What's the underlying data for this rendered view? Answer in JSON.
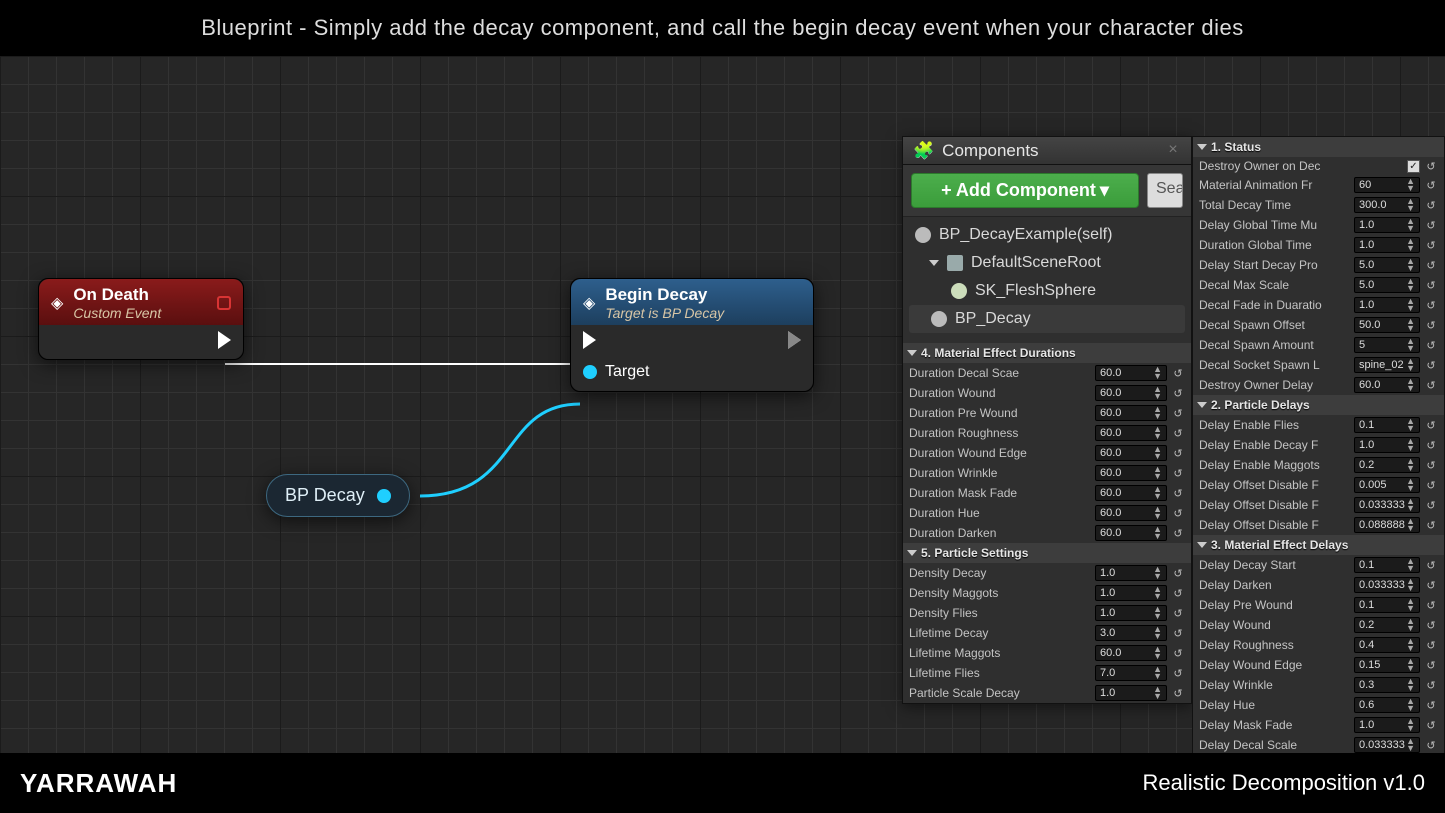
{
  "header": {
    "title": "Blueprint - Simply add the decay component, and call the begin decay event when your character dies"
  },
  "footer": {
    "brand": "YARRAWAH",
    "product": "Realistic Decomposition   v1.0"
  },
  "nodes": {
    "onDeath": {
      "title": "On Death",
      "subtitle": "Custom Event"
    },
    "beginDecay": {
      "title": "Begin Decay",
      "subtitle": "Target is BP Decay",
      "targetLabel": "Target"
    },
    "variable": {
      "label": "BP Decay"
    }
  },
  "componentsPanel": {
    "title": "Components",
    "addLabel": "+ Add Component",
    "searchPlaceholder": "Sea",
    "items": [
      {
        "label": "BP_DecayExample(self)",
        "indent": 0,
        "icon": "sphere"
      },
      {
        "label": "DefaultSceneRoot",
        "indent": 1,
        "icon": "cube",
        "expandable": true
      },
      {
        "label": "SK_FleshSphere",
        "indent": 2,
        "icon": "skel"
      },
      {
        "label": "BP_Decay",
        "indent": 1,
        "icon": "sphere",
        "selected": true
      }
    ]
  },
  "details": {
    "sec4": {
      "title": "4. Material Effect Durations",
      "rows": [
        {
          "label": "Duration Decal Scae",
          "value": "60.0"
        },
        {
          "label": "Duration Wound",
          "value": "60.0"
        },
        {
          "label": "Duration Pre Wound",
          "value": "60.0"
        },
        {
          "label": "Duration Roughness",
          "value": "60.0"
        },
        {
          "label": "Duration Wound Edge",
          "value": "60.0"
        },
        {
          "label": "Duration Wrinkle",
          "value": "60.0"
        },
        {
          "label": "Duration Mask Fade",
          "value": "60.0"
        },
        {
          "label": "Duration Hue",
          "value": "60.0"
        },
        {
          "label": "Duration Darken",
          "value": "60.0"
        }
      ]
    },
    "sec5": {
      "title": "5. Particle Settings",
      "rows": [
        {
          "label": "Density Decay",
          "value": "1.0"
        },
        {
          "label": "Density Maggots",
          "value": "1.0"
        },
        {
          "label": "Density Flies",
          "value": "1.0"
        },
        {
          "label": "Lifetime Decay",
          "value": "3.0"
        },
        {
          "label": "Lifetime Maggots",
          "value": "60.0"
        },
        {
          "label": "Lifetime Flies",
          "value": "7.0"
        },
        {
          "label": "Particle Scale Decay",
          "value": "1.0"
        }
      ]
    },
    "sec1": {
      "title": "1. Status",
      "rows": [
        {
          "label": "Destroy Owner on Dec",
          "type": "check",
          "value": true
        },
        {
          "label": "Material Animation Fr",
          "value": "60"
        },
        {
          "label": "Total Decay Time",
          "value": "300.0"
        },
        {
          "label": "Delay Global Time Mu",
          "value": "1.0"
        },
        {
          "label": "Duration Global Time",
          "value": "1.0"
        },
        {
          "label": "Delay Start Decay Pro",
          "value": "5.0"
        },
        {
          "label": "Decal Max Scale",
          "value": "5.0"
        },
        {
          "label": "Decal Fade in Duaratio",
          "value": "1.0"
        },
        {
          "label": "Decal Spawn Offset",
          "value": "50.0"
        },
        {
          "label": "Decal Spawn Amount",
          "value": "5"
        },
        {
          "label": "Decal Socket Spawn L",
          "type": "text",
          "value": "spine_02"
        },
        {
          "label": "Destroy Owner Delay",
          "value": "60.0"
        }
      ]
    },
    "sec2": {
      "title": "2. Particle Delays",
      "rows": [
        {
          "label": "Delay Enable Flies",
          "value": "0.1"
        },
        {
          "label": "Delay Enable Decay F",
          "value": "1.0"
        },
        {
          "label": "Delay Enable Maggots",
          "value": "0.2"
        },
        {
          "label": "Delay Offset Disable F",
          "value": "0.005"
        },
        {
          "label": "Delay Offset Disable F",
          "value": "0.033333"
        },
        {
          "label": "Delay Offset Disable F",
          "value": "0.088888"
        }
      ]
    },
    "sec3": {
      "title": "3. Material Effect Delays",
      "rows": [
        {
          "label": "Delay Decay Start",
          "value": "0.1"
        },
        {
          "label": "Delay Darken",
          "value": "0.033333"
        },
        {
          "label": "Delay Pre Wound",
          "value": "0.1"
        },
        {
          "label": "Delay Wound",
          "value": "0.2"
        },
        {
          "label": "Delay Roughness",
          "value": "0.4"
        },
        {
          "label": "Delay Wound Edge",
          "value": "0.15"
        },
        {
          "label": "Delay Wrinkle",
          "value": "0.3"
        },
        {
          "label": "Delay Hue",
          "value": "0.6"
        },
        {
          "label": "Delay Mask Fade",
          "value": "1.0"
        },
        {
          "label": "Delay Decal Scale",
          "value": "0.033333"
        }
      ]
    }
  }
}
